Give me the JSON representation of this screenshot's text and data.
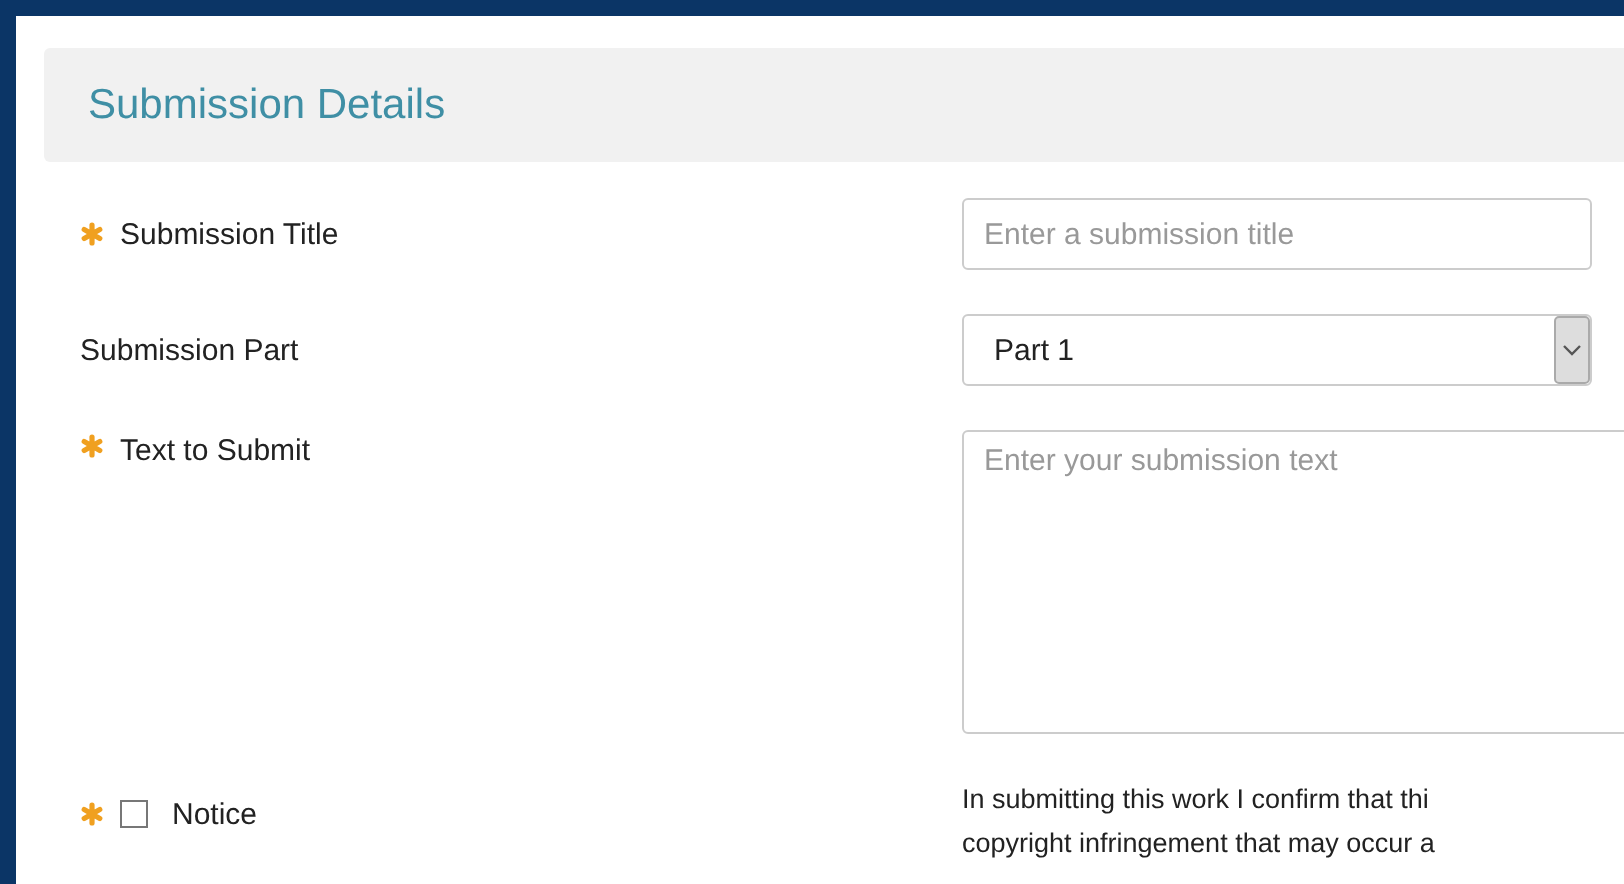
{
  "section": {
    "title": "Submission Details"
  },
  "fields": [
    {
      "kind": "text",
      "label": "Submission Title",
      "required": true,
      "placeholder": "Enter a submission title"
    },
    {
      "kind": "select",
      "label": "Submission Part",
      "required": false,
      "value": "Part 1"
    },
    {
      "kind": "textarea",
      "label": "Text to Submit",
      "required": true,
      "placeholder": "Enter your submission text"
    },
    {
      "kind": "checkbox",
      "label": "Notice",
      "required": true,
      "checked": false,
      "notice_lines": [
        "In submitting this work I confirm that thi",
        "copyright infringement that may occur a"
      ]
    }
  ]
}
